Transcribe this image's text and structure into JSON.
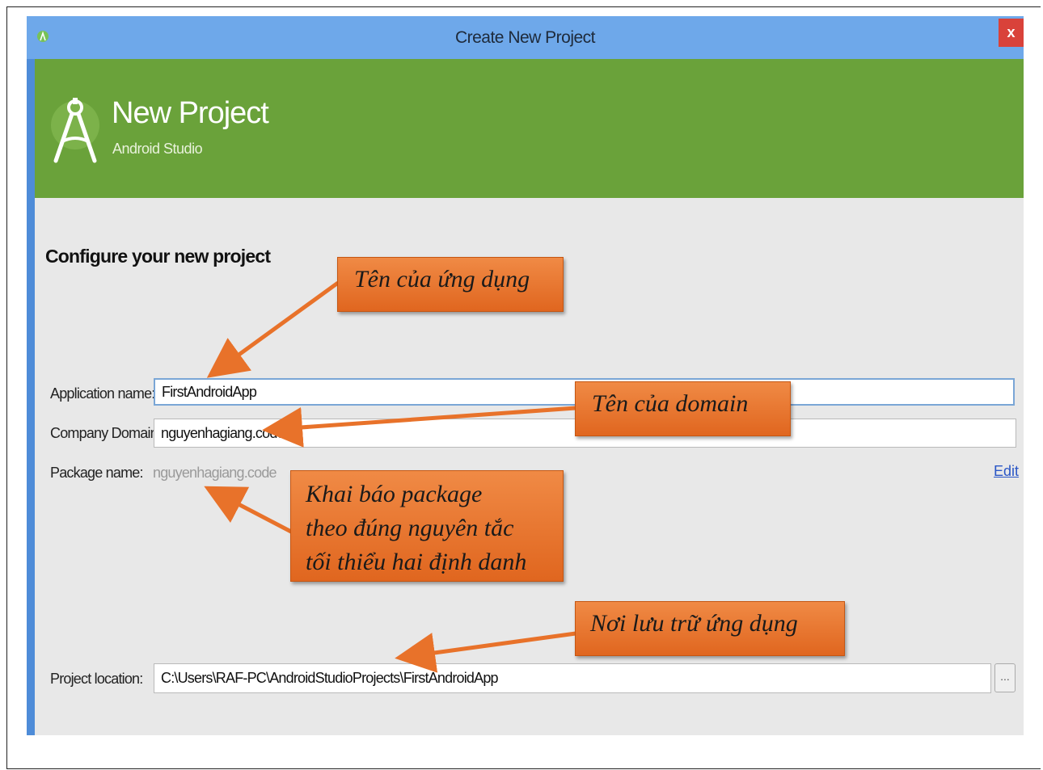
{
  "window": {
    "title": "Create New Project",
    "close_label": "x"
  },
  "banner": {
    "title": "New Project",
    "subtitle": "Android Studio"
  },
  "form": {
    "heading": "Configure your new project",
    "app_name_label": "Application name:",
    "app_name_value": "FirstAndroidApp",
    "company_domain_label": "Company Domain:",
    "company_domain_value": "nguyenhagiang.code",
    "package_name_label": "Package name:",
    "package_name_value": "nguyenhagiang.code",
    "edit_label": "Edit",
    "project_location_label": "Project location:",
    "project_location_value": "C:\\Users\\RAF-PC\\AndroidStudioProjects\\FirstAndroidApp",
    "browse_label": "..."
  },
  "callouts": {
    "app_name": "Tên của ứng dụng",
    "domain": "Tên của domain",
    "package_line1": "Khai báo package",
    "package_line2": "theo đúng nguyên tắc",
    "package_line3": "tối thiểu hai định danh",
    "location": "Nơi lưu trữ ứng dụng"
  },
  "colors": {
    "titlebar": "#6ea8ea",
    "banner": "#6aa23a",
    "close": "#d9423a",
    "callout": "#e8722a",
    "arrow": "#e8722a"
  }
}
